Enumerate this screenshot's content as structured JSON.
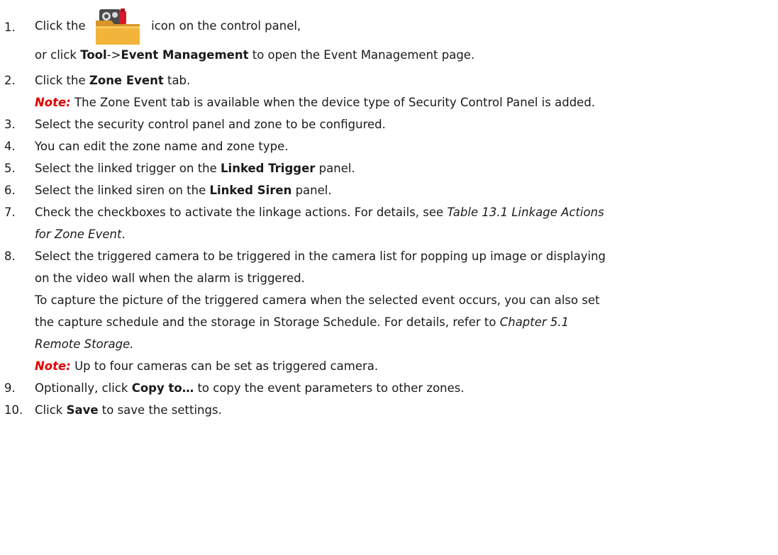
{
  "steps": [
    {
      "num": "1.",
      "pre": "Click the",
      "post": "icon on the control panel,",
      "line2_pre": "or click ",
      "tool": "Tool",
      "arrow": "->",
      "event_mgmt": "Event Management",
      "line2_post": " to open the Event Management page.",
      "icon": "event-management-folder-icon"
    },
    {
      "num": "2.",
      "pre": "Click the ",
      "bold": "Zone Event",
      "post": " tab.",
      "note_label": "Note:",
      "note_text": " The Zone Event tab is available when the device type of Security Control Panel is added."
    },
    {
      "num": "3.",
      "text": "Select the security control panel and zone to be configured."
    },
    {
      "num": "4.",
      "text": "You can edit the zone name and zone type."
    },
    {
      "num": "5.",
      "pre": "Select the linked trigger on the ",
      "bold": "Linked Trigger",
      "post": " panel."
    },
    {
      "num": "6.",
      "pre": "Select the linked siren on the ",
      "bold": "Linked Siren",
      "post": " panel."
    },
    {
      "num": "7.",
      "pre": "Check the checkboxes to activate the linkage actions. For details, see ",
      "italic1": "Table 13.1 Linkage Actions",
      "italic2": "for Zone Event",
      "post": "."
    },
    {
      "num": "8.",
      "line1": "Select the triggered camera to be triggered in the camera list for popping up image or displaying",
      "line2": "on the video wall when the alarm is triggered.",
      "line3": "To capture the picture of the triggered camera when the selected event occurs, you can also set",
      "line4_pre": "the capture schedule and the storage in Storage Schedule. For details, refer to ",
      "line4_italic": "Chapter 5.1",
      "line5_italic": "Remote Storage.",
      "note_label": "Note:",
      "note_text": " Up to four cameras can be set as triggered camera."
    },
    {
      "num": "9.",
      "pre": "Optionally, click ",
      "bold": "Copy to…",
      "post": " to copy the event parameters to other zones."
    },
    {
      "num": "10.",
      "pre": "Click ",
      "bold": "Save",
      "post": " to save the settings."
    }
  ],
  "colors": {
    "text": "#1a1a1a",
    "note": "#e00000",
    "folder": "#f2b43a",
    "icon_dark": "#4a4a4a",
    "icon_red": "#d8192b"
  }
}
